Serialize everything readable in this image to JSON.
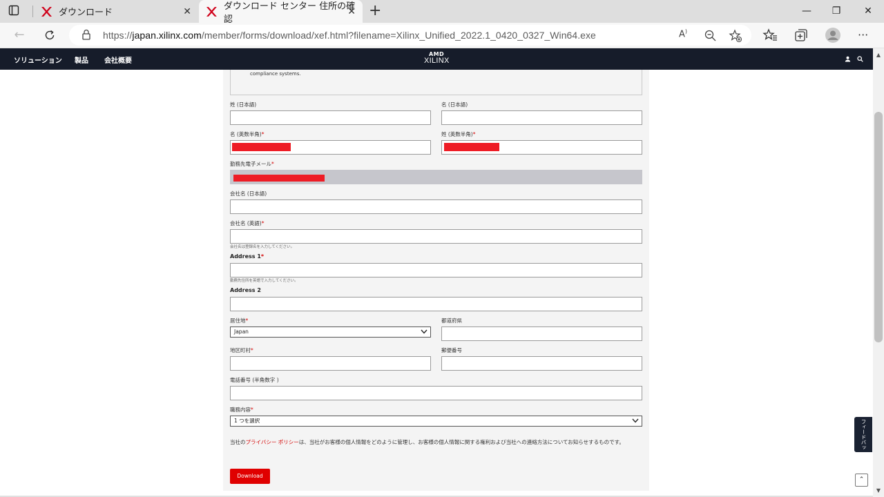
{
  "browser": {
    "tabs": [
      {
        "title": "ダウンロード"
      },
      {
        "title": "ダウンロード センター 住所の確認"
      }
    ],
    "url_prefix": "https://",
    "url_domain": "japan.xilinx.com",
    "url_path": "/member/forms/download/xef.html?filename=Xilinx_Unified_2022.1_0420_0327_Win64.exe"
  },
  "site_nav": {
    "items": [
      "ソリューション",
      "製品",
      "会社概要"
    ],
    "logo_top": "AMD",
    "logo_bottom": "XILINX"
  },
  "form": {
    "notice_tail": "compliance systems.",
    "last_name_jp_label": "姓 (日本語)",
    "first_name_jp_label": "名 (日本語)",
    "first_name_en_label": "名 (英数半角)",
    "last_name_en_label": "姓 (英数半角)",
    "email_label": "勤務先電子メール",
    "company_jp_label": "会社名 (日本語)",
    "company_en_label": "会社名 (英語)",
    "company_en_hint": "会社名は登録名を入力してください。",
    "address1_label": "Address 1",
    "address1_hint": "勤務先住所を英語で入力してください。",
    "address2_label": "Address 2",
    "country_label": "居住地",
    "country_value": "Japan",
    "prefecture_label": "都道府県",
    "city_label": "地区町村",
    "postal_label": "郵便番号",
    "phone_label": "電話番号 (半角数字 )",
    "job_label": "職務内容",
    "job_value": "1 つを選択",
    "required_mark": "*",
    "privacy_pre": "当社の",
    "privacy_link": "プライバシー ポリシー",
    "privacy_post": "は、当社がお客様の個人情報をどのように管理し、お客様の個人情報に関する権利および当社への連絡方法についてお知らせするものです。",
    "download_label": "Download"
  },
  "feedback_label": "フィードバック",
  "colors": {
    "nav_bg": "#161c2a",
    "accent_red": "#e00000",
    "redaction": "#ee1c25"
  }
}
